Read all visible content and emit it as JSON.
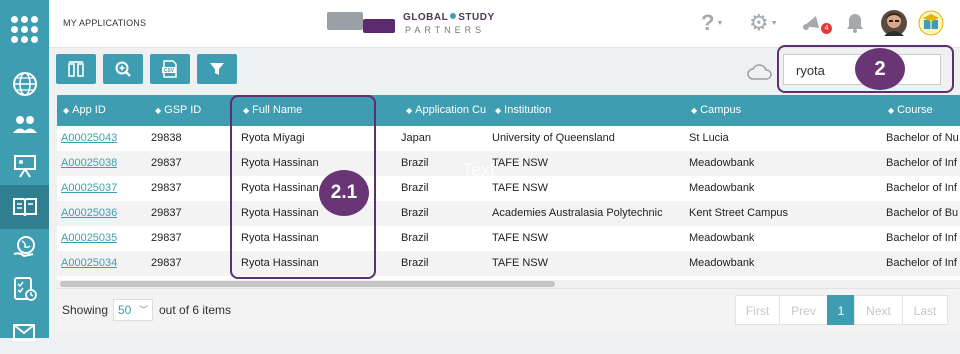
{
  "app": {
    "section_title": "MY APPLICATIONS"
  },
  "brand": {
    "line1_a": "GLOBAL",
    "line1_b": "STUDY",
    "line2": "PARTNERS"
  },
  "topbar": {
    "notification_count": "4"
  },
  "search": {
    "value": "ryota"
  },
  "callouts": {
    "search": "2",
    "fullname": "2.1"
  },
  "watermark": "Text",
  "table": {
    "columns": [
      "App ID",
      "GSP ID",
      "Full Name",
      "Application Cu",
      "Institution",
      "Campus",
      "Course"
    ],
    "rows": [
      [
        "A00025043",
        "29838",
        "Ryota Miyagi",
        "Japan",
        "University of Queensland",
        "St Lucia",
        "Bachelor of Nu"
      ],
      [
        "A00025038",
        "29837",
        "Ryota Hassinan",
        "Brazil",
        "TAFE NSW",
        "Meadowbank",
        "Bachelor of Inf"
      ],
      [
        "A00025037",
        "29837",
        "Ryota Hassinan",
        "Brazil",
        "TAFE NSW",
        "Meadowbank",
        "Bachelor of Inf"
      ],
      [
        "A00025036",
        "29837",
        "Ryota Hassinan",
        "Brazil",
        "Academies Australasia Polytechnic",
        "Kent Street Campus",
        "Bachelor of Bu"
      ],
      [
        "A00025035",
        "29837",
        "Ryota Hassinan",
        "Brazil",
        "TAFE NSW",
        "Meadowbank",
        "Bachelor of Inf"
      ],
      [
        "A00025034",
        "29837",
        "Ryota Hassinan",
        "Brazil",
        "TAFE NSW",
        "Meadowbank",
        "Bachelor of Inf"
      ]
    ]
  },
  "pager": {
    "showing_label": "Showing",
    "page_size": "50",
    "out_of_label": "out of 6 items",
    "first": "First",
    "prev": "Prev",
    "current": "1",
    "next": "Next",
    "last": "Last"
  },
  "colors": {
    "accent": "#3e9db0",
    "callout": "#5e2e6e",
    "link": "#3e9db0"
  }
}
